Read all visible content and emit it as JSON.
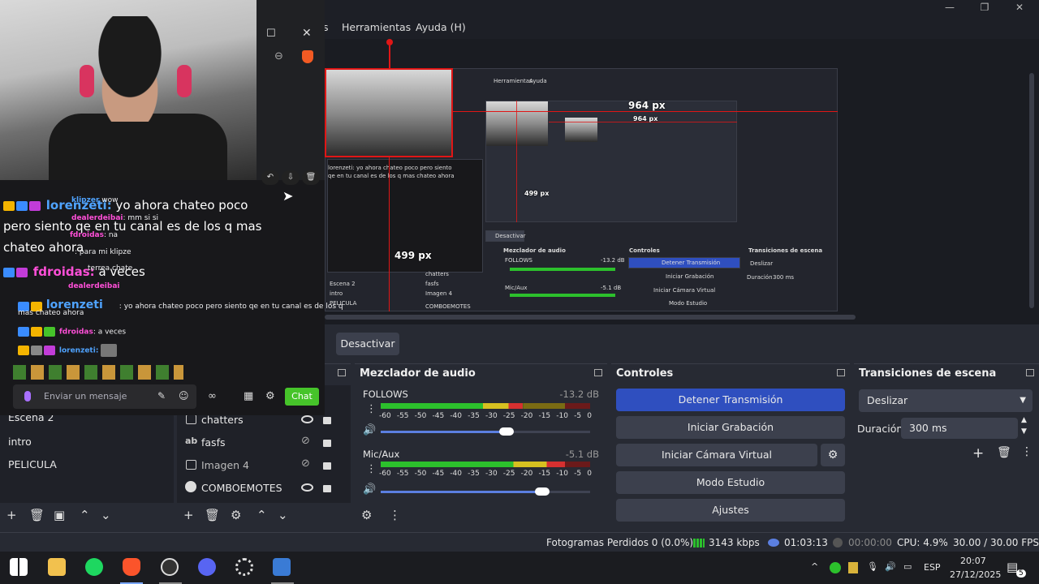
{
  "window": {
    "controls": {
      "minimize": "—",
      "maximize": "❐",
      "close": "✕"
    }
  },
  "menu": {
    "partial_label": "s",
    "items": [
      "Herramientas",
      "Ayuda (H)"
    ]
  },
  "preview": {
    "width_label": "964 px",
    "height_label": "499 px",
    "nested_width_label": "964 px",
    "nested_height_label": "499 px",
    "nested_menu": [
      "Herramientas",
      "Ayuda"
    ],
    "chat_excerpt": "lorenzeti: yo ahora chateo poco pero siento qe en tu canal es de los q mas chateo ahora",
    "nested_desactivar": "Desactivar",
    "nested_mixer": "Mezclador de audio",
    "nested_controls": "Controles",
    "nested_transitions": "Transiciones de escena",
    "nested_stream": "Detener Transmisión",
    "nested_record": "Iniciar Grabación",
    "nested_vcam": "Iniciar Cámara Virtual",
    "nested_studio": "Modo Estudio",
    "nested_slide": "Deslizar",
    "nested_duration": "Duración",
    "nested_duration_value": "300 ms",
    "nested_scenes": [
      "Escena 2",
      "intro",
      "PELICULA"
    ],
    "nested_sources": [
      "chatters",
      "fasfs",
      "Imagen 4",
      "COMBOEMOTES"
    ],
    "nested_db": [
      "-13.2 dB",
      "-5.1 dB"
    ],
    "nested_mixer_names": [
      "FOLLOWS",
      "Mic/Aux"
    ]
  },
  "toolbar": {
    "desactivar": "Desactivar"
  },
  "scenes": {
    "items": [
      "Escena 2",
      "intro",
      "PELICULA"
    ]
  },
  "sources": {
    "items": [
      {
        "name": "chatters",
        "icon": "browser-icon",
        "visible": true
      },
      {
        "name": "fasfs",
        "icon": "text-icon",
        "visible": false
      },
      {
        "name": "Imagen 4",
        "icon": "image-icon",
        "visible": false
      },
      {
        "name": "COMBOEMOTES",
        "icon": "globe-icon",
        "visible": true
      }
    ]
  },
  "mixer": {
    "title": "Mezclador de audio",
    "channels": [
      {
        "name": "FOLLOWS",
        "db": "-13.2 dB",
        "level": 0.68,
        "volume": 0.6
      },
      {
        "name": "Mic/Aux",
        "db": "-5.1 dB",
        "level": 0.88,
        "volume": 0.77
      }
    ],
    "ticks": [
      "-60",
      "-55",
      "-50",
      "-45",
      "-40",
      "-35",
      "-30",
      "-25",
      "-20",
      "-15",
      "-10",
      "-5",
      "0"
    ]
  },
  "controls": {
    "title": "Controles",
    "stop_stream": "Detener Transmisión",
    "start_record": "Iniciar Grabación",
    "start_vcam": "Iniciar Cámara Virtual",
    "studio_mode": "Modo Estudio",
    "settings": "Ajustes"
  },
  "transitions": {
    "title": "Transiciones de escena",
    "selected": "Deslizar",
    "duration_label": "Duración",
    "duration_value": "300 ms"
  },
  "status": {
    "dropped": "Fotogramas Perdidos 0 (0.0%)",
    "bitrate": "3143 kbps",
    "stream_time": "01:03:13",
    "record_time": "00:00:00",
    "cpu": "CPU: 4.9%",
    "fps": "30.00 / 30.00 FPS"
  },
  "chat": {
    "big_user": "lorenzeti:",
    "big_message": " yo ahora chateo poco",
    "big_line2": "pero siento qe en tu canal es de los q mas",
    "big_line3": "chateo ahora",
    "big_user2": "fdroidas:",
    "big_message2": " a veces",
    "small_lines": [
      {
        "user": "klipzer",
        "text": " wow"
      },
      {
        "user": "dealerdeibai",
        "text": ": mm si si"
      },
      {
        "user": "fdroidas",
        "text": ": na"
      },
      {
        "user": "",
        "text": ": para mi klipze"
      },
      {
        "user": "",
        "text": " terrea chate"
      }
    ],
    "user3": "dealerdeibai",
    "user4": "lorenzeti",
    "msg4_a": ": yo ahora chateo poco pero siento qe en tu canal es de los q",
    "msg4_b": "mas chateo ahora",
    "user5": "fdroidas",
    "msg5": ": a veces",
    "user6": "lorenzeti:",
    "placeholder": "Enviar un mensaje",
    "send": "Chat"
  },
  "taskbar": {
    "language": "ESP",
    "time": "20:07",
    "date": "27/12/2025",
    "notifications": "5"
  },
  "colors": {
    "obs_bg": "#272a33",
    "accent_blue": "#2f4fbf",
    "twitch_green": "#46c42a",
    "selection_red": "#e01616"
  }
}
